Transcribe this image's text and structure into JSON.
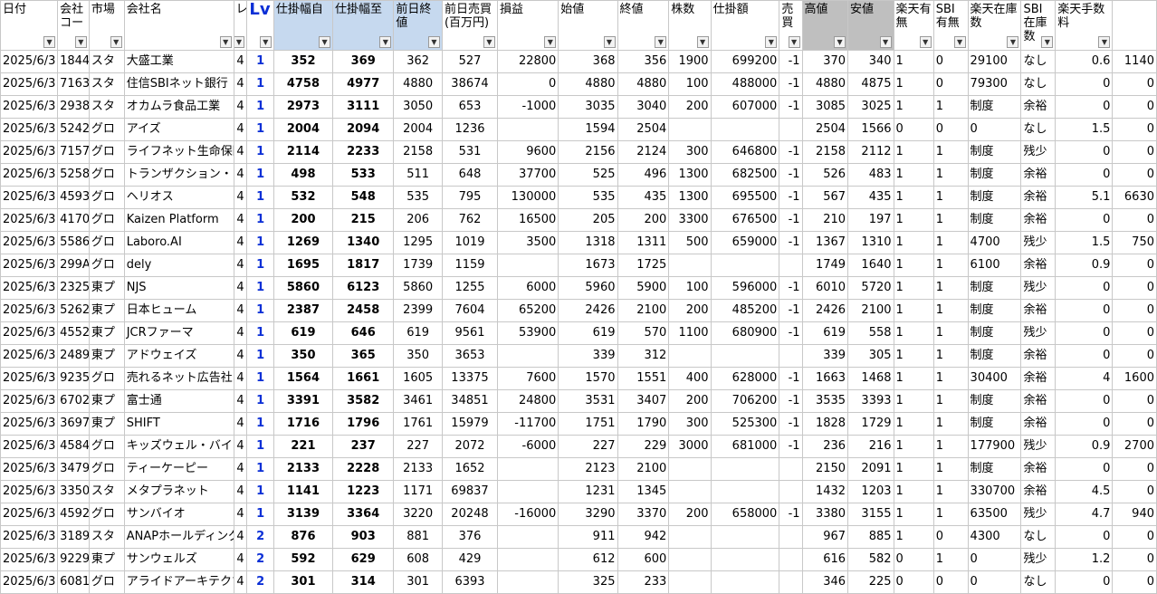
{
  "headers": [
    "日付",
    "会社コード",
    "市場",
    "会社名",
    "レ",
    "Lv",
    "仕掛幅自",
    "仕掛幅至",
    "前日終値",
    "前日売買(百万円)",
    "損益",
    "始値",
    "終値",
    "株数",
    "仕掛額",
    "売買",
    "高値",
    "安値",
    "楽天有無",
    "SBI有無",
    "楽天在庫数",
    "SBI在庫数",
    "楽天手数料",
    ""
  ],
  "headers_shown": [
    "日付",
    "会社コー",
    "市場",
    "会社名",
    "レ",
    "Lv",
    "仕掛幅自",
    "仕掛幅至",
    "前日終値",
    "前日売買(百万円)",
    "損益",
    "始値",
    "終値",
    "株数",
    "仕掛額",
    "売買",
    "高値",
    "安値",
    "楽天有無",
    "SBI有無",
    "楽天在庫数",
    "SBI在庫数",
    "楽天手数料",
    ""
  ],
  "filter_icon": "dropdown-arrow-icon",
  "rows": [
    [
      "2025/6/3",
      "1844",
      "スタ",
      "大盛工業",
      "4",
      "1",
      "352",
      "369",
      "362",
      "527",
      "22800",
      "368",
      "356",
      "1900",
      "699200",
      "-1",
      "370",
      "340",
      "1",
      "0",
      "29100",
      "なし",
      "0.6",
      "1140"
    ],
    [
      "2025/6/3",
      "7163",
      "スタ",
      "住信SBIネット銀行",
      "4",
      "1",
      "4758",
      "4977",
      "4880",
      "38674",
      "0",
      "4880",
      "4880",
      "100",
      "488000",
      "-1",
      "4880",
      "4875",
      "1",
      "0",
      "79300",
      "なし",
      "0",
      "0"
    ],
    [
      "2025/6/3",
      "2938",
      "スタ",
      "オカムラ食品工業",
      "4",
      "1",
      "2973",
      "3111",
      "3050",
      "653",
      "-1000",
      "3035",
      "3040",
      "200",
      "607000",
      "-1",
      "3085",
      "3025",
      "1",
      "1",
      "制度",
      "余裕",
      "0",
      "0"
    ],
    [
      "2025/6/3",
      "5242",
      "グロ",
      "アイズ",
      "4",
      "1",
      "2004",
      "2094",
      "2004",
      "1236",
      "",
      "1594",
      "2504",
      "",
      "",
      "",
      "2504",
      "1566",
      "0",
      "0",
      "0",
      "なし",
      "1.5",
      "0"
    ],
    [
      "2025/6/3",
      "7157",
      "グロ",
      "ライフネット生命保険",
      "4",
      "1",
      "2114",
      "2233",
      "2158",
      "531",
      "9600",
      "2156",
      "2124",
      "300",
      "646800",
      "-1",
      "2158",
      "2112",
      "1",
      "1",
      "制度",
      "残少",
      "0",
      "0"
    ],
    [
      "2025/6/3",
      "5258",
      "グロ",
      "トランザクション・メディア",
      "4",
      "1",
      "498",
      "533",
      "511",
      "648",
      "37700",
      "525",
      "496",
      "1300",
      "682500",
      "-1",
      "526",
      "483",
      "1",
      "1",
      "制度",
      "余裕",
      "0",
      "0"
    ],
    [
      "2025/6/3",
      "4593",
      "グロ",
      "ヘリオス",
      "4",
      "1",
      "532",
      "548",
      "535",
      "795",
      "130000",
      "535",
      "435",
      "1300",
      "695500",
      "-1",
      "567",
      "435",
      "1",
      "1",
      "制度",
      "余裕",
      "5.1",
      "6630"
    ],
    [
      "2025/6/3",
      "4170",
      "グロ",
      "Kaizen Platform",
      "4",
      "1",
      "200",
      "215",
      "206",
      "762",
      "16500",
      "205",
      "200",
      "3300",
      "676500",
      "-1",
      "210",
      "197",
      "1",
      "1",
      "制度",
      "余裕",
      "0",
      "0"
    ],
    [
      "2025/6/3",
      "5586",
      "グロ",
      "Laboro.AI",
      "4",
      "1",
      "1269",
      "1340",
      "1295",
      "1019",
      "3500",
      "1318",
      "1311",
      "500",
      "659000",
      "-1",
      "1367",
      "1310",
      "1",
      "1",
      "4700",
      "残少",
      "1.5",
      "750"
    ],
    [
      "2025/6/3",
      "299A",
      "グロ",
      "dely",
      "4",
      "1",
      "1695",
      "1817",
      "1739",
      "1159",
      "",
      "1673",
      "1725",
      "",
      "",
      "",
      "1749",
      "1640",
      "1",
      "1",
      "6100",
      "余裕",
      "0.9",
      "0"
    ],
    [
      "2025/6/3",
      "2325",
      "東プ",
      "NJS",
      "4",
      "1",
      "5860",
      "6123",
      "5860",
      "1255",
      "6000",
      "5960",
      "5900",
      "100",
      "596000",
      "-1",
      "6010",
      "5720",
      "1",
      "1",
      "制度",
      "残少",
      "0",
      "0"
    ],
    [
      "2025/6/3",
      "5262",
      "東プ",
      "日本ヒューム",
      "4",
      "1",
      "2387",
      "2458",
      "2399",
      "7604",
      "65200",
      "2426",
      "2100",
      "200",
      "485200",
      "-1",
      "2426",
      "2100",
      "1",
      "1",
      "制度",
      "余裕",
      "0",
      "0"
    ],
    [
      "2025/6/3",
      "4552",
      "東プ",
      "JCRファーマ",
      "4",
      "1",
      "619",
      "646",
      "619",
      "9561",
      "53900",
      "619",
      "570",
      "1100",
      "680900",
      "-1",
      "619",
      "558",
      "1",
      "1",
      "制度",
      "残少",
      "0",
      "0"
    ],
    [
      "2025/6/3",
      "2489",
      "東プ",
      "アドウェイズ",
      "4",
      "1",
      "350",
      "365",
      "350",
      "3653",
      "",
      "339",
      "312",
      "",
      "",
      "",
      "339",
      "305",
      "1",
      "1",
      "制度",
      "余裕",
      "0",
      "0"
    ],
    [
      "2025/6/3",
      "9235",
      "グロ",
      "売れるネット広告社",
      "4",
      "1",
      "1564",
      "1661",
      "1605",
      "13375",
      "7600",
      "1570",
      "1551",
      "400",
      "628000",
      "-1",
      "1663",
      "1468",
      "1",
      "1",
      "30400",
      "余裕",
      "4",
      "1600"
    ],
    [
      "2025/6/3",
      "6702",
      "東プ",
      "富士通",
      "4",
      "1",
      "3391",
      "3582",
      "3461",
      "34851",
      "24800",
      "3531",
      "3407",
      "200",
      "706200",
      "-1",
      "3535",
      "3393",
      "1",
      "1",
      "制度",
      "余裕",
      "0",
      "0"
    ],
    [
      "2025/6/3",
      "3697",
      "東プ",
      "SHIFT",
      "4",
      "1",
      "1716",
      "1796",
      "1761",
      "15979",
      "-11700",
      "1751",
      "1790",
      "300",
      "525300",
      "-1",
      "1828",
      "1729",
      "1",
      "1",
      "制度",
      "余裕",
      "0",
      "0"
    ],
    [
      "2025/6/3",
      "4584",
      "グロ",
      "キッズウェル・バイオ",
      "4",
      "1",
      "221",
      "237",
      "227",
      "2072",
      "-6000",
      "227",
      "229",
      "3000",
      "681000",
      "-1",
      "236",
      "216",
      "1",
      "1",
      "177900",
      "残少",
      "0.9",
      "2700"
    ],
    [
      "2025/6/3",
      "3479",
      "グロ",
      "ティーケーピー",
      "4",
      "1",
      "2133",
      "2228",
      "2133",
      "1652",
      "",
      "2123",
      "2100",
      "",
      "",
      "",
      "2150",
      "2091",
      "1",
      "1",
      "制度",
      "余裕",
      "0",
      "0"
    ],
    [
      "2025/6/3",
      "3350",
      "スタ",
      "メタプラネット",
      "4",
      "1",
      "1141",
      "1223",
      "1171",
      "69837",
      "",
      "1231",
      "1345",
      "",
      "",
      "",
      "1432",
      "1203",
      "1",
      "1",
      "330700",
      "余裕",
      "4.5",
      "0"
    ],
    [
      "2025/6/3",
      "4592",
      "グロ",
      "サンバイオ",
      "4",
      "1",
      "3139",
      "3364",
      "3220",
      "20248",
      "-16000",
      "3290",
      "3370",
      "200",
      "658000",
      "-1",
      "3380",
      "3155",
      "1",
      "1",
      "63500",
      "残少",
      "4.7",
      "940"
    ],
    [
      "2025/6/3",
      "3189",
      "スタ",
      "ANAPホールディングス",
      "4",
      "2",
      "876",
      "903",
      "881",
      "376",
      "",
      "911",
      "942",
      "",
      "",
      "",
      "967",
      "885",
      "1",
      "0",
      "4300",
      "なし",
      "0",
      "0"
    ],
    [
      "2025/6/3",
      "9229",
      "東プ",
      "サンウェルズ",
      "4",
      "2",
      "592",
      "629",
      "608",
      "429",
      "",
      "612",
      "600",
      "",
      "",
      "",
      "616",
      "582",
      "0",
      "1",
      "0",
      "残少",
      "1.2",
      "0"
    ],
    [
      "2025/6/3",
      "6081",
      "グロ",
      "アライドアーキテクツ",
      "4",
      "2",
      "301",
      "314",
      "301",
      "6393",
      "",
      "325",
      "233",
      "",
      "",
      "",
      "346",
      "225",
      "0",
      "0",
      "0",
      "なし",
      "0",
      "0"
    ]
  ]
}
